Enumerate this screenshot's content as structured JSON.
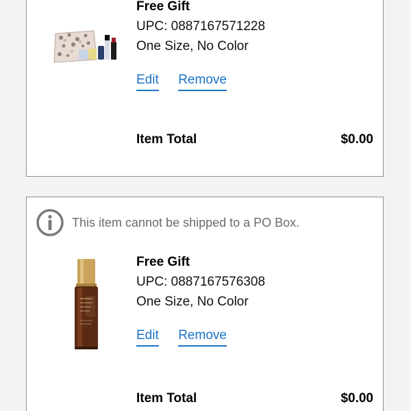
{
  "items": [
    {
      "name": "Free Gift",
      "upc": "UPC: 0887167571228",
      "variant": "One Size, No Color",
      "edit_label": "Edit",
      "remove_label": "Remove",
      "total_label": "Item Total",
      "total_value": "$0.00",
      "image": "cosmetic-gift-set-bag-icon"
    },
    {
      "notice": "This item cannot be shipped to a PO Box.",
      "notice_icon": "info-icon",
      "name": "Free Gift",
      "upc": "UPC: 0887167576308",
      "variant": "One Size, No Color",
      "edit_label": "Edit",
      "remove_label": "Remove",
      "total_label": "Item Total",
      "total_value": "$0.00",
      "image": "serum-bottle-icon"
    }
  ],
  "colors": {
    "link": "#1a73c8",
    "border": "#8e8e8e",
    "background": "#f3f3f3",
    "notice_text": "#6b6b6b"
  }
}
